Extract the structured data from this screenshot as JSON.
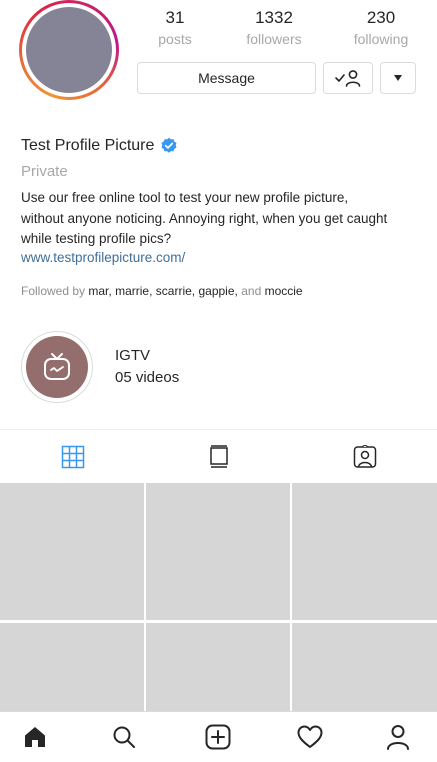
{
  "profile": {
    "name": "Test Profile Picture",
    "account_status": "Private",
    "bio_lines": [
      "Use our free online tool to test your new profile picture,",
      "without anyone noticing. Annoying right, when you get caught",
      "while testing profile pics?"
    ],
    "website": "www.testprofilepicture.com/"
  },
  "stats": {
    "posts": {
      "count": "31",
      "label": "posts"
    },
    "followers": {
      "count": "1332",
      "label": "followers"
    },
    "following": {
      "count": "230",
      "label": "following"
    }
  },
  "actions": {
    "message_label": "Message"
  },
  "followed_by": {
    "prefix": "Followed by",
    "users": [
      "mar",
      "marrie",
      "scarrie",
      "gappie"
    ],
    "conjunction": "and",
    "last_user": "moccie"
  },
  "highlight": {
    "title": "IGTV",
    "subtitle": "05 videos"
  },
  "tabs": [
    {
      "icon": "grid-icon",
      "active": true
    },
    {
      "icon": "igtv-feed-icon",
      "active": false
    },
    {
      "icon": "tagged-icon",
      "active": false
    }
  ],
  "bottom_nav": [
    {
      "icon": "home-icon"
    },
    {
      "icon": "search-icon"
    },
    {
      "icon": "new-post-icon"
    },
    {
      "icon": "heart-icon"
    },
    {
      "icon": "profile-icon"
    }
  ],
  "colors": {
    "avatar_fill": "#858396",
    "highlight_fill": "#946e6c",
    "link": "#3f6f99",
    "active_tab": "#3897f0",
    "verified_badge": "#3897f0",
    "grid_placeholder": "#d6d6d6"
  }
}
